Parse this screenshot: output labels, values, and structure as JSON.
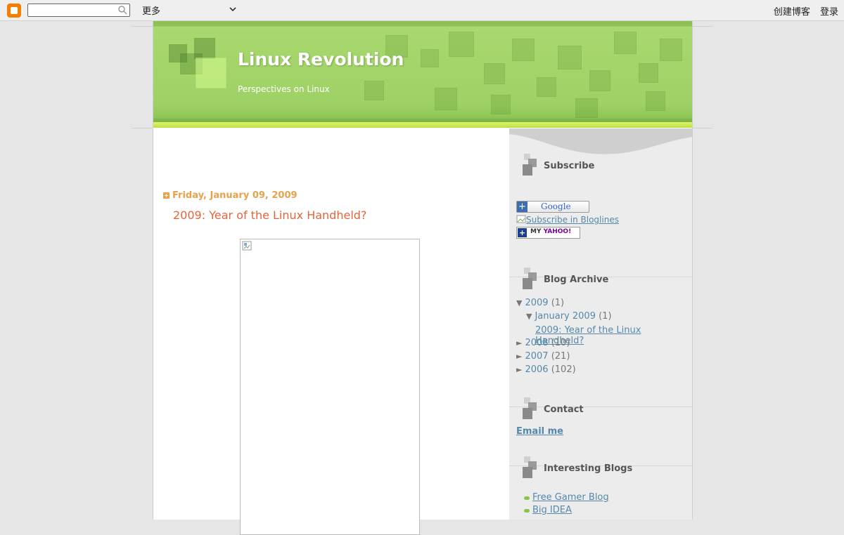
{
  "navbar": {
    "search_placeholder": "",
    "more_label": "更多",
    "create_blog": "创建博客",
    "sign_in": "登录"
  },
  "header": {
    "title": "Linux Revolution",
    "description": "Perspectives on Linux"
  },
  "post": {
    "date": "Friday, January 09, 2009",
    "title": "2009: Year of the Linux Handheld?"
  },
  "sidebar": {
    "subscribe": {
      "title": "Subscribe",
      "google_label": "Google",
      "bloglines_label": "Subscribe in Bloglines",
      "yahoo_label_my": "MY",
      "yahoo_label_yahoo": "YAHOO!"
    },
    "archive": {
      "title": "Blog Archive",
      "years": [
        {
          "label": "2009",
          "count": "(1)"
        },
        {
          "label": "2008",
          "count": "(10)"
        },
        {
          "label": "2007",
          "count": "(21)"
        },
        {
          "label": "2006",
          "count": "(102)"
        }
      ],
      "month": {
        "label": "January 2009",
        "count": "(1)"
      },
      "post_link": "2009: Year of the Linux Handheld?"
    },
    "contact": {
      "title": "Contact",
      "email_label": "Email me"
    },
    "interesting": {
      "title": "Interesting Blogs",
      "links": [
        "Free Gamer Blog",
        "Big IDEA"
      ]
    }
  },
  "colors": {
    "accent_orange": "#e4653a",
    "date_orange": "#e6a24d",
    "link_blue": "#5588aa",
    "header_green": "#9ed165"
  }
}
